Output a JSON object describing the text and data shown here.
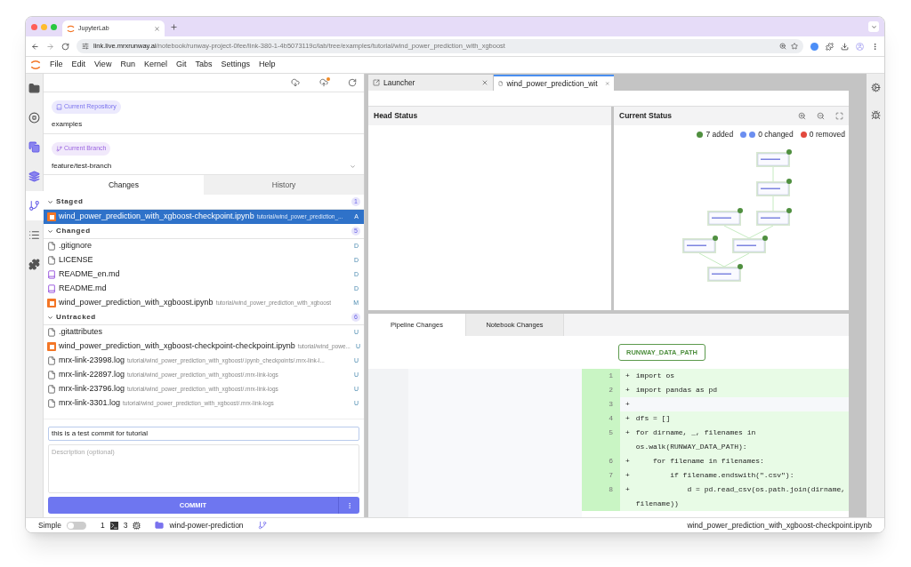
{
  "browser": {
    "tab_title": "JupyterLab",
    "url_host": "link.live.mrxrunway.ai",
    "url_path": "/notebook/runway-project-0fee/link-380-1-4b5073119c/lab/tree/examples/tutorial/wind_power_prediction_with_xgboost"
  },
  "menu": [
    "File",
    "Edit",
    "View",
    "Run",
    "Kernel",
    "Git",
    "Tabs",
    "Settings",
    "Help"
  ],
  "activity_bar": [
    {
      "kind": "folder",
      "selected": false
    },
    {
      "kind": "stop",
      "selected": false
    },
    {
      "kind": "stack",
      "selected": false
    },
    {
      "kind": "layers",
      "selected": false
    },
    {
      "kind": "git",
      "selected": true
    },
    {
      "kind": "list",
      "selected": false
    },
    {
      "kind": "puzzle",
      "selected": false
    }
  ],
  "git": {
    "repository_label": "Current Repository",
    "repository": "examples",
    "branch_label": "Current Branch",
    "branch": "feature/test-branch",
    "tabs": [
      {
        "label": "Changes",
        "selected": true
      },
      {
        "label": "History",
        "selected": false
      }
    ],
    "sections": [
      {
        "title": "Staged",
        "count": "1",
        "expanded": true,
        "files": [
          {
            "kind": "notebook",
            "name": "wind_power_prediction_with_xgboost-checkpoint.ipynb",
            "path": "tutorial/wind_power_prediction_...",
            "status": "A",
            "selected": true
          }
        ]
      },
      {
        "title": "Changed",
        "count": "5",
        "expanded": true,
        "files": [
          {
            "kind": "file",
            "name": ".gitignore",
            "status": "D",
            "selected": false
          },
          {
            "kind": "file",
            "name": "LICENSE",
            "status": "D",
            "selected": false
          },
          {
            "kind": "markdown",
            "name": "README_en.md",
            "status": "D",
            "selected": false
          },
          {
            "kind": "markdown",
            "name": "README.md",
            "status": "D",
            "selected": false
          },
          {
            "kind": "notebook",
            "name": "wind_power_prediction_with_xgboost.ipynb",
            "path": "tutorial/wind_power_prediction_with_xgboost",
            "status": "M",
            "selected": false
          }
        ]
      },
      {
        "title": "Untracked",
        "count": "6",
        "expanded": true,
        "files": [
          {
            "kind": "file",
            "name": ".gitattributes",
            "status": "U",
            "selected": false
          },
          {
            "kind": "notebook",
            "name": "wind_power_prediction_with_xgboost-checkpoint-checkpoint.ipynb",
            "path": "tutorial/wind_powe...",
            "status": "U",
            "selected": false
          },
          {
            "kind": "file",
            "name": "mrx-link-23998.log",
            "path": "tutorial/wind_power_prediction_with_xgboost/.ipynb_checkpoints/.mrx-link-l...",
            "status": "U",
            "selected": false
          },
          {
            "kind": "file",
            "name": "mrx-link-22897.log",
            "path": "tutorial/wind_power_prediction_with_xgboost/.mrx-link-logs",
            "status": "U",
            "selected": false
          },
          {
            "kind": "file",
            "name": "mrx-link-23796.log",
            "path": "tutorial/wind_power_prediction_with_xgboost/.mrx-link-logs",
            "status": "U",
            "selected": false
          },
          {
            "kind": "file",
            "name": "mrx-link-3301.log",
            "path": "tutorial/wind_power_prediction_with_xgboost/.mrx-link-logs",
            "status": "U",
            "selected": false
          }
        ]
      }
    ],
    "commit": {
      "summary": "this is a test commit for tutorial",
      "description_placeholder": "Description (optional)",
      "button": "COMMIT"
    }
  },
  "documents": {
    "tabs": [
      {
        "label": "Launcher",
        "kind": "launcher",
        "selected": false
      },
      {
        "label": "wind_power_prediction_wit",
        "kind": "notebook",
        "selected": true
      }
    ]
  },
  "head_status": {
    "title": "Head Status"
  },
  "current_status": {
    "title": "Current Status",
    "legend": [
      {
        "kind": "added",
        "text": "7 added",
        "color": "#4f8f3f"
      },
      {
        "kind": "changed",
        "text": "0 changed",
        "color": "#6b8ef0"
      },
      {
        "kind": "removed",
        "text": "0 removed",
        "color": "#e2483d"
      }
    ]
  },
  "diff": {
    "tabs": [
      {
        "label": "Pipeline Changes",
        "selected": true
      },
      {
        "label": "Notebook Changes",
        "selected": false
      }
    ],
    "variable": "RUNWAY_DATA_PATH",
    "lines": [
      {
        "kind": "added",
        "number": "1",
        "marker": "+",
        "code": "import os"
      },
      {
        "kind": "added",
        "number": "2",
        "marker": "+",
        "code": "import pandas as pd"
      },
      {
        "kind": "blank",
        "number": "3",
        "marker": "+"
      },
      {
        "kind": "added",
        "number": "4",
        "marker": "+",
        "code": "dfs = []"
      },
      {
        "kind": "added",
        "number": "5",
        "marker": "+",
        "code": "for dirname, _, filenames in os.walk(RUNWAY_DATA_PATH):"
      },
      {
        "kind": "added",
        "number": "6",
        "marker": "+",
        "code": "    for filename in filenames:"
      },
      {
        "kind": "added",
        "number": "7",
        "marker": "+",
        "code": "        if filename.endswith(\".csv\"):"
      },
      {
        "kind": "added",
        "number": "8",
        "marker": "+",
        "code": "            d = pd.read_csv(os.path.join(dirname, filename))"
      }
    ]
  },
  "status_bar": {
    "mode_label": "Simple",
    "simple_mode": false,
    "terminals": "1",
    "kernels": "3",
    "folder": "wind-power-prediction",
    "file": "wind_power_prediction_with_xgboost-checkpoint.ipynb"
  }
}
